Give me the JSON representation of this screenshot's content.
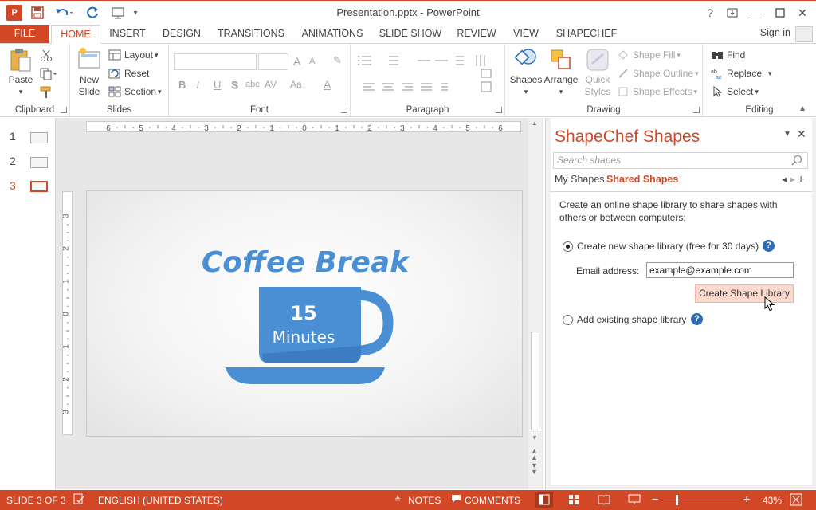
{
  "window": {
    "title": "Presentation.pptx - PowerPoint",
    "logo_letter": "P",
    "help_label": "?",
    "minimize_label": "—",
    "close_label": "✕"
  },
  "tabs": [
    "FILE",
    "HOME",
    "INSERT",
    "DESIGN",
    "TRANSITIONS",
    "ANIMATIONS",
    "SLIDE SHOW",
    "REVIEW",
    "VIEW",
    "SHAPECHEF"
  ],
  "sign_in": "Sign in",
  "ribbon": {
    "clipboard": {
      "label": "Clipboard",
      "paste": "Paste"
    },
    "slides": {
      "label": "Slides",
      "new_slide_1": "New",
      "new_slide_2": "Slide",
      "layout": "Layout",
      "reset": "Reset",
      "section": "Section"
    },
    "font": {
      "label": "Font",
      "bold": "B",
      "italic": "I",
      "underline": "U",
      "shadow": "S",
      "strike": "abc",
      "spacing": "AV",
      "case": "Aa",
      "grow": "A",
      "shrink": "A",
      "color": "A"
    },
    "paragraph": {
      "label": "Paragraph"
    },
    "drawing": {
      "label": "Drawing",
      "shapes": "Shapes",
      "arrange": "Arrange",
      "quick_styles_1": "Quick",
      "quick_styles_2": "Styles",
      "shape_fill": "Shape Fill",
      "shape_outline": "Shape Outline",
      "shape_effects": "Shape Effects"
    },
    "editing": {
      "label": "Editing",
      "find": "Find",
      "replace": "Replace",
      "select": "Select"
    }
  },
  "thumbnails": [
    {
      "number": "1"
    },
    {
      "number": "2"
    },
    {
      "number": "3"
    }
  ],
  "ruler": {
    "h_marks": [
      "6",
      "5",
      "4",
      "3",
      "2",
      "1",
      "0",
      "1",
      "2",
      "3",
      "4",
      "5",
      "6"
    ],
    "v_marks": [
      "3",
      "2",
      "1",
      "0",
      "1",
      "2",
      "3"
    ]
  },
  "slide": {
    "title": "Coffee Break",
    "cup_number": "15",
    "cup_unit": "Minutes",
    "accent": "#4a8fd4"
  },
  "pane": {
    "title": "ShapeChef Shapes",
    "search_placeholder": "Search shapes",
    "tab_my": "My Shapes",
    "tab_shared": "Shared Shapes",
    "description": "Create an online shape library to share shapes with others or between computers:",
    "option_create": "Create new shape library (free for 30 days)",
    "email_label": "Email address:",
    "email_value": "example@example.com",
    "create_button": "Create Shape Library",
    "option_existing": "Add existing shape library",
    "help": "?"
  },
  "status": {
    "slide_info": "SLIDE 3 OF 3",
    "language": "ENGLISH (UNITED STATES)",
    "notes": "NOTES",
    "comments": "COMMENTS",
    "zoom": "43%"
  },
  "colors": {
    "accent": "#d24726",
    "cup": "#4a8fd4"
  }
}
